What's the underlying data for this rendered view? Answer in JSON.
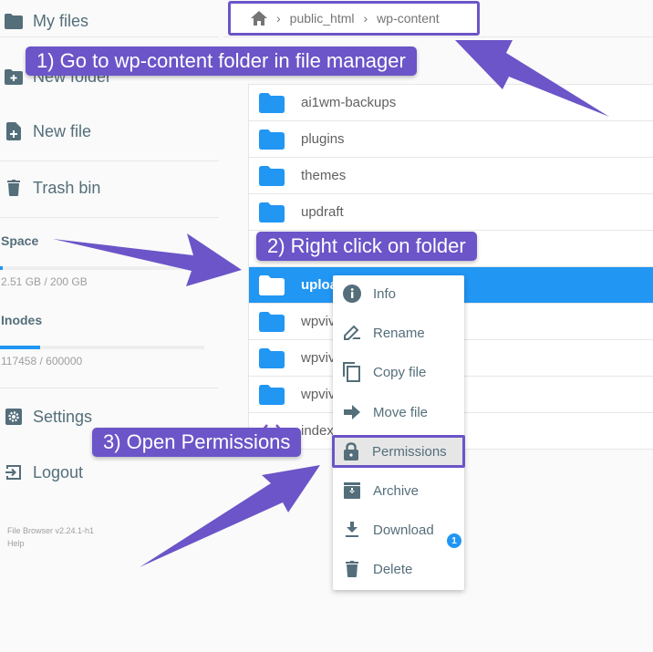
{
  "sidebar": {
    "items": [
      {
        "label": "My files",
        "icon": "folder-icon"
      },
      {
        "label": "New folder",
        "icon": "new-folder-icon"
      },
      {
        "label": "New file",
        "icon": "new-file-icon"
      },
      {
        "label": "Trash bin",
        "icon": "trash-icon"
      }
    ],
    "space": {
      "title": "Space",
      "text": "2.51 GB / 200 GB",
      "used_fraction": 0.0126
    },
    "inodes": {
      "title": "Inodes",
      "text": "117458 / 600000",
      "used_fraction": 0.196
    },
    "bottom_items": [
      {
        "label": "Settings",
        "icon": "settings-icon"
      },
      {
        "label": "Logout",
        "icon": "logout-icon"
      }
    ],
    "footer": {
      "version": "File Browser v2.24.1-h1",
      "help": "Help"
    }
  },
  "breadcrumb": {
    "home_icon": "home-icon",
    "separator": "›",
    "parts": [
      "public_html",
      "wp-content"
    ]
  },
  "files": [
    {
      "name": "ai1wm-backups",
      "type": "folder"
    },
    {
      "name": "plugins",
      "type": "folder"
    },
    {
      "name": "themes",
      "type": "folder"
    },
    {
      "name": "updraft",
      "type": "folder"
    },
    {
      "name": "",
      "type": "hidden-row"
    },
    {
      "name": "uploads",
      "type": "folder",
      "selected": true
    },
    {
      "name": "wpvivid-backups",
      "type": "folder"
    },
    {
      "name": "wpvivid-temp",
      "type": "folder"
    },
    {
      "name": "wpvivid-uploads",
      "type": "folder"
    },
    {
      "name": "index.php",
      "type": "code"
    }
  ],
  "context_menu": {
    "items": [
      {
        "label": "Info",
        "icon": "info-icon"
      },
      {
        "label": "Rename",
        "icon": "rename-icon"
      },
      {
        "label": "Copy file",
        "icon": "copy-icon"
      },
      {
        "label": "Move file",
        "icon": "move-icon"
      },
      {
        "label": "Permissions",
        "icon": "lock-icon",
        "highlighted": true
      },
      {
        "label": "Archive",
        "icon": "archive-icon"
      },
      {
        "label": "Download",
        "icon": "download-icon"
      },
      {
        "label": "Delete",
        "icon": "delete-icon"
      }
    ],
    "badge": "1"
  },
  "callouts": {
    "step1": "1) Go to wp-content folder in file manager",
    "step2": "2) Right click on folder",
    "step3": "3) Open Permissions"
  },
  "colors": {
    "accent": "#2196f3",
    "annotation": "#6b55c8",
    "icon": "#546e7a"
  }
}
